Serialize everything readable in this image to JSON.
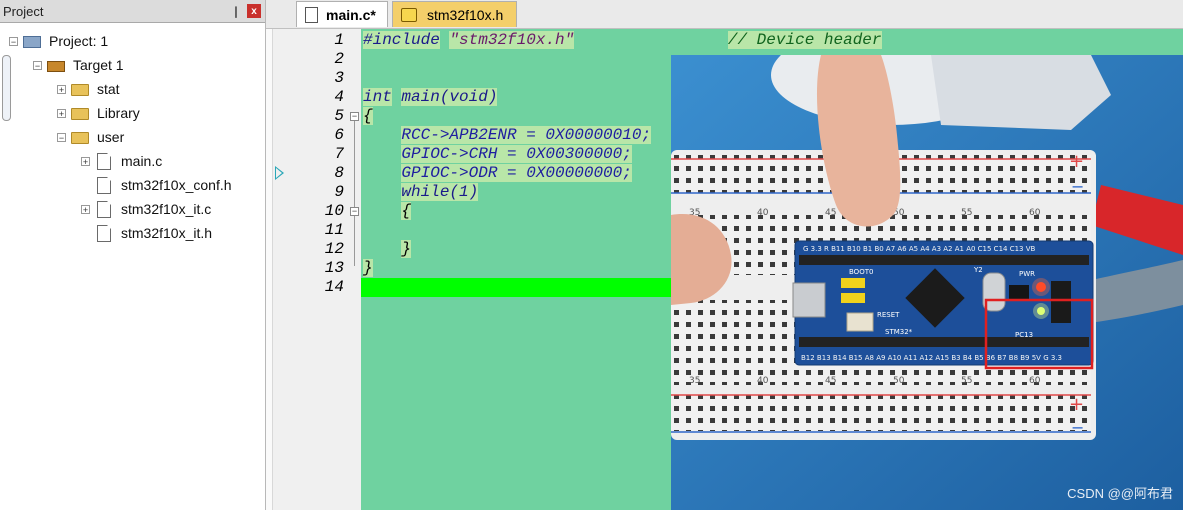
{
  "project_panel": {
    "title": "Project",
    "pin_glyph": "❘",
    "close_glyph": "x",
    "tree": {
      "project": "Project: 1",
      "target": "Target 1",
      "groups": [
        "stat",
        "Library",
        "user"
      ],
      "files": [
        "main.c",
        "stm32f10x_conf.h",
        "stm32f10x_it.c",
        "stm32f10x_it.h"
      ]
    }
  },
  "tabs": [
    "main.c*",
    "stm32f10x.h"
  ],
  "line_numbers": [
    "1",
    "2",
    "3",
    "4",
    "5",
    "6",
    "7",
    "8",
    "9",
    "10",
    "11",
    "12",
    "13",
    "14"
  ],
  "code": {
    "l1_include": "#include",
    "l1_file": "\"stm32f10x.h\"",
    "l1_comment": "// Device header",
    "l4_type": "int",
    "l4_sig": "main(void)",
    "l5": "{",
    "l6": "RCC->APB2ENR = 0X00000010;",
    "l7": "GPIOC->CRH = 0X00300000;",
    "l8": "GPIOC->ODR = 0X00000000;",
    "l9": "while(1)",
    "l10": "{",
    "l12": "}",
    "l13": "}"
  },
  "photo": {
    "board_label": "STM32*",
    "top_pins": "G 3.3 R B11 B10 B1 B0 A7 A6 A5 A4 A3 A2 A1 A0 C15 C14 C13 VB",
    "bottom_pins": "B12 B13 B14 B15 A8 A9 A10 A11 A12 A15 B3 B4 B5 B6 B7 B8 B9 5V G 3.3",
    "boot_label": "BOOT0",
    "reset_label": "RESET",
    "pwr_label": "PWR",
    "pc13_label": "PC13",
    "y2_label": "Y2",
    "col_numbers_top": [
      "35",
      "40",
      "45",
      "50",
      "55",
      "60"
    ],
    "col_numbers_bottom": [
      "35",
      "40",
      "45",
      "50",
      "55",
      "60"
    ],
    "watermark": "CSDN @@阿布君"
  },
  "colors": {
    "editor_bg": "#6fd2a0",
    "current_line": "#00ff00",
    "header_tab": "#f4cf6a",
    "highlight_box": "#e02020"
  }
}
